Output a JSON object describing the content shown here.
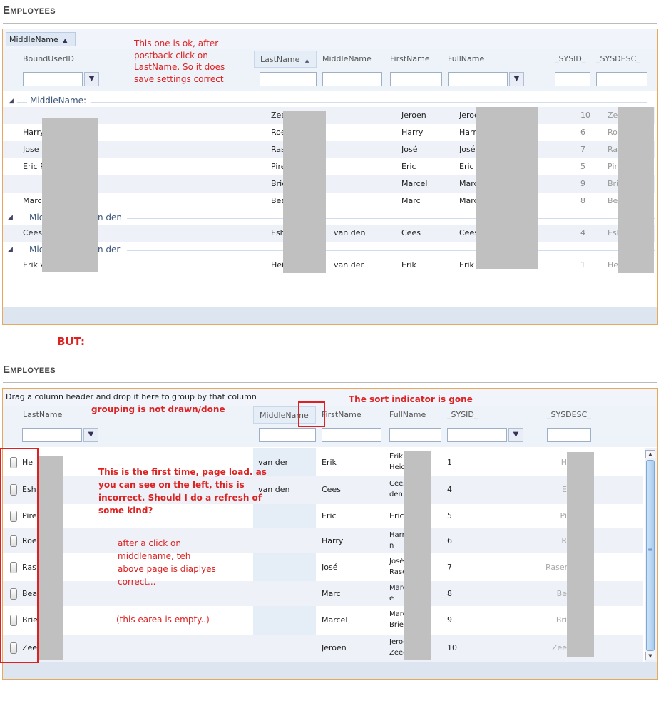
{
  "top": {
    "title": "Employees",
    "group_pill": "MiddleName",
    "group_pill_arrow": "▲",
    "headers": {
      "bound": "BoundUserID",
      "last": "LastName",
      "last_arrow": "▲",
      "middle": "MiddleName",
      "first": "FirstName",
      "full": "FullName",
      "sysid": "_SYSID_",
      "sysdesc": "_SYSDESC_"
    },
    "filter_icon": "funnel-icon",
    "groups": [
      {
        "caption": "MiddleName:",
        "visible": "MiddleName:"
      },
      {
        "caption": "Mid",
        "suffix": "n den"
      },
      {
        "caption": "Mid",
        "suffix": "n der"
      }
    ],
    "rows": [
      {
        "bound": "",
        "last": "Zee",
        "middle": "",
        "first": "Jeroen",
        "full": "Jeroe",
        "sysid": "10",
        "sysdesc": "Zee"
      },
      {
        "bound": "Harry",
        "last": "Roe",
        "middle": "",
        "first": "Harry",
        "full": "Harr",
        "sysid": "6",
        "sysdesc": "Ro"
      },
      {
        "bound": "Jose I",
        "last": "Ras",
        "middle": "",
        "first": "José",
        "full": "José",
        "sysid": "7",
        "sysdesc": "Ras"
      },
      {
        "bound": "Eric P",
        "last": "Pire",
        "middle": "",
        "first": "Eric",
        "full": "Eric",
        "sysid": "5",
        "sysdesc": "Pir"
      },
      {
        "bound": "",
        "last": "Brie",
        "middle": "",
        "first": "Marcel",
        "full": "Marc",
        "sysid": "9",
        "sysdesc": "Bri"
      },
      {
        "bound": "Marc",
        "last": "Bea",
        "middle": "",
        "first": "Marc",
        "full": "Marc",
        "sysid": "8",
        "sysdesc": "Bea"
      },
      {
        "bound": "Cees",
        "last": "Esh",
        "middle": "van den",
        "first": "Cees",
        "full": "Cees",
        "sysid": "4",
        "sysdesc": "Esh"
      },
      {
        "bound": "Erik v",
        "last": "Hei",
        "middle": "van der",
        "first": "Erik",
        "full": "Erik v",
        "sysid": "1",
        "sysdesc": "He"
      }
    ],
    "annotation": [
      "This one is ok, after",
      "postback click on",
      "LastName. So it does",
      "save settings correct"
    ]
  },
  "but_label": "BUT:",
  "bottom": {
    "title": "Employees",
    "group_hint": "Drag a column header and drop it here to group by that column",
    "headers": {
      "last": "LastName",
      "middle": "MiddleName",
      "first": "FirstName",
      "full": "FullName",
      "sysid": "_SYSID_",
      "sysdesc": "_SYSDESC_"
    },
    "rows": [
      {
        "last": "Hei",
        "middle": "van der",
        "first": "Erik",
        "full1": "Erik v",
        "full2": "Heid",
        "sysid": "1",
        "sysdesc": "H"
      },
      {
        "last": "Esh",
        "middle": "van den",
        "first": "Cees",
        "full1": "Cees",
        "full2": "den",
        "sysid": "4",
        "sysdesc": "E"
      },
      {
        "last": "Pire",
        "middle": "",
        "first": "Eric",
        "full1": "Eric",
        "full2": "",
        "sysid": "5",
        "sysdesc": "Pi"
      },
      {
        "last": "Roe",
        "middle": "",
        "first": "Harry",
        "full1": "Harr",
        "full2": "n",
        "sysid": "6",
        "sysdesc": "R"
      },
      {
        "last": "Ras",
        "middle": "",
        "first": "José",
        "full1": "José",
        "full2": "Rase",
        "sysid": "7",
        "sysdesc": "Rasen"
      },
      {
        "last": "Bea",
        "middle": "",
        "first": "Marc",
        "full1": "Marc",
        "full2": "e",
        "sysid": "8",
        "sysdesc": "Be"
      },
      {
        "last": "Brie",
        "middle": "",
        "first": "Marcel",
        "full1": "Marc",
        "full2": "Brien",
        "sysid": "9",
        "sysdesc": "Bri"
      },
      {
        "last": "Zee",
        "middle": "",
        "first": "Jeroen",
        "full1": "Jeroe",
        "full2": "Zeeg",
        "sysid": "10",
        "sysdesc": "Zee"
      }
    ],
    "notes": {
      "sort_gone": "The sort indicator is gone",
      "grouping": "grouping is not drawn/done",
      "first_time": [
        "This is the first time, page load. as",
        "you can see on the left, this is",
        "incorrect. Should I do a refresh of",
        "some kind?"
      ],
      "after_click": [
        "after a click on",
        "middlename, teh",
        "above page is diaplyes",
        "correct..."
      ],
      "empty": "(this earea is empty..)"
    },
    "scroll_up": "▲",
    "scroll_down": "▼",
    "scroll_grip": "≡"
  }
}
